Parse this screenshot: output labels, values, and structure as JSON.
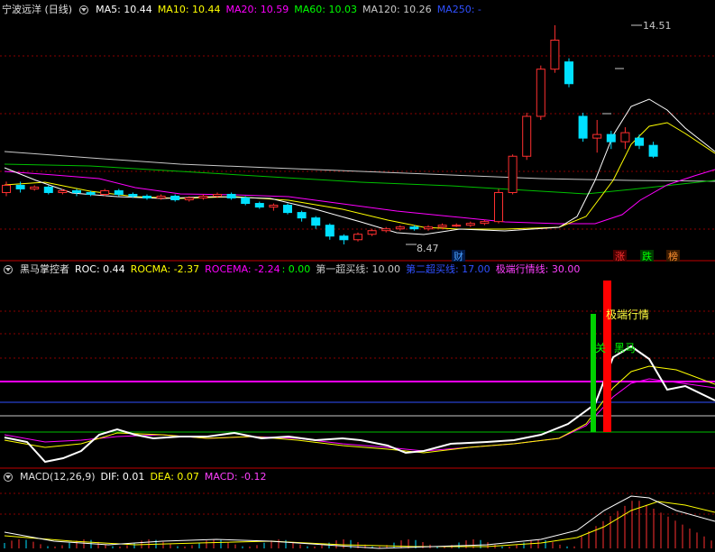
{
  "main_panel": {
    "title": "宁波远洋 (日线)",
    "indicators": [
      {
        "label": "MA5: 10.44",
        "color": "#ffffff"
      },
      {
        "label": "MA10: 10.44",
        "color": "#ffff00"
      },
      {
        "label": "MA20: 10.59",
        "color": "#ff00ff"
      },
      {
        "label": "MA60: 10.03",
        "color": "#00ff00"
      },
      {
        "label": "MA120: 10.26",
        "color": "#c8c8c8"
      },
      {
        "label": "MA250: -",
        "color": "#3050ff"
      }
    ],
    "high_label": "14.51",
    "low_label": "8.47",
    "markers": {
      "cai": "财",
      "zhang": "涨",
      "die": "跌",
      "bang": "榜"
    }
  },
  "roc_panel": {
    "title": "黑马掌控者",
    "indicators": [
      {
        "label": "ROC: 0.44",
        "color": "#ffffff"
      },
      {
        "label": "ROCMA: -2.37",
        "color": "#ffff00"
      },
      {
        "label": "ROCEMA: -2.24",
        "color": "#ff00ff"
      },
      {
        "label": ": 0.00",
        "color": "#00ff00"
      },
      {
        "label": "第一超买线: 10.00",
        "color": "#c8c8c8"
      },
      {
        "label": "第二超买线: 17.00",
        "color": "#3050ff"
      },
      {
        "label": "极端行情线: 30.00",
        "color": "#ff40ff"
      }
    ],
    "annotation_extreme": "极端行情",
    "annotation_guan": "关",
    "annotation_heima": "黑马"
  },
  "macd_panel": {
    "title": "MACD(12,26,9)",
    "indicators": [
      {
        "label": "DIF: 0.01",
        "color": "#ffffff"
      },
      {
        "label": "DEA: 0.07",
        "color": "#ffff00"
      },
      {
        "label": "MACD: -0.12",
        "color": "#ff40ff"
      }
    ]
  },
  "colors": {
    "up": "#ff3030",
    "down": "#00e0ff",
    "grid": "#b00000"
  },
  "chart_data": {
    "type": "candlestick",
    "candles": [
      [
        9.9,
        10.1,
        9.8,
        10.2
      ],
      [
        10.1,
        10.0,
        9.9,
        10.2
      ],
      [
        10.0,
        10.05,
        9.95,
        10.1
      ],
      [
        10.05,
        9.9,
        9.85,
        10.1
      ],
      [
        9.9,
        9.95,
        9.85,
        10.0
      ],
      [
        9.95,
        9.9,
        9.8,
        10.0
      ],
      [
        9.9,
        9.85,
        9.8,
        9.95
      ],
      [
        9.85,
        9.95,
        9.8,
        10.0
      ],
      [
        9.95,
        9.85,
        9.8,
        10.0
      ],
      [
        9.85,
        9.8,
        9.75,
        9.9
      ],
      [
        9.8,
        9.75,
        9.7,
        9.85
      ],
      [
        9.75,
        9.8,
        9.7,
        9.85
      ],
      [
        9.8,
        9.7,
        9.65,
        9.85
      ],
      [
        9.7,
        9.75,
        9.65,
        9.8
      ],
      [
        9.75,
        9.8,
        9.7,
        9.85
      ],
      [
        9.8,
        9.85,
        9.75,
        9.9
      ],
      [
        9.85,
        9.75,
        9.7,
        9.9
      ],
      [
        9.75,
        9.6,
        9.55,
        9.8
      ],
      [
        9.6,
        9.5,
        9.45,
        9.65
      ],
      [
        9.5,
        9.55,
        9.4,
        9.6
      ],
      [
        9.55,
        9.35,
        9.3,
        9.6
      ],
      [
        9.35,
        9.2,
        9.1,
        9.4
      ],
      [
        9.2,
        9.0,
        8.9,
        9.25
      ],
      [
        9.0,
        8.7,
        8.6,
        9.05
      ],
      [
        8.7,
        8.6,
        8.47,
        8.75
      ],
      [
        8.6,
        8.75,
        8.55,
        8.8
      ],
      [
        8.75,
        8.85,
        8.7,
        8.9
      ],
      [
        8.85,
        8.9,
        8.8,
        8.95
      ],
      [
        8.9,
        8.95,
        8.85,
        9.0
      ],
      [
        8.95,
        8.9,
        8.85,
        9.0
      ],
      [
        8.9,
        8.95,
        8.85,
        9.0
      ],
      [
        8.95,
        9.0,
        8.9,
        9.05
      ],
      [
        9.0,
        9.0,
        8.95,
        9.05
      ],
      [
        9.0,
        9.05,
        8.95,
        9.1
      ],
      [
        9.05,
        9.1,
        9.0,
        9.15
      ],
      [
        9.1,
        9.9,
        9.05,
        10.0
      ],
      [
        9.9,
        10.9,
        9.85,
        10.95
      ],
      [
        10.9,
        12.0,
        10.8,
        12.1
      ],
      [
        12.0,
        13.3,
        11.9,
        13.4
      ],
      [
        13.3,
        14.1,
        13.2,
        14.51
      ],
      [
        13.5,
        12.9,
        12.8,
        13.6
      ],
      [
        12.0,
        11.4,
        11.3,
        12.1
      ],
      [
        11.4,
        11.5,
        11.0,
        11.9
      ],
      [
        11.5,
        11.3,
        11.1,
        11.6
      ],
      [
        11.3,
        11.55,
        11.1,
        11.7
      ],
      [
        11.4,
        11.2,
        11.1,
        11.5
      ],
      [
        11.2,
        10.9,
        10.85,
        11.3
      ]
    ]
  }
}
